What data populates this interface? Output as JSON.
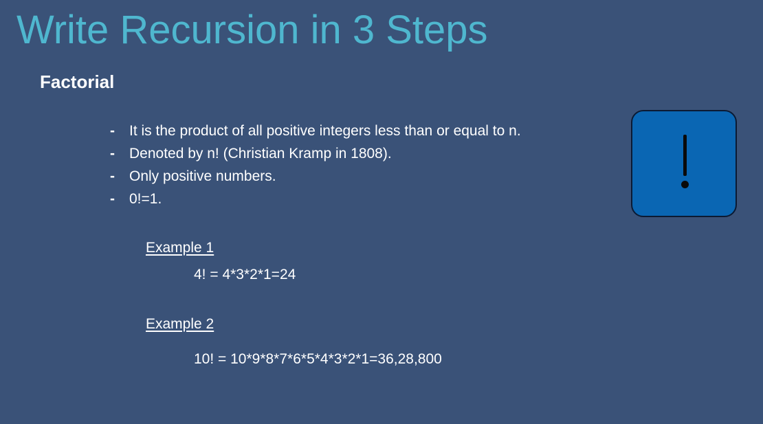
{
  "slide": {
    "title": "Write Recursion in 3 Steps",
    "subtitle": "Factorial",
    "bullets": [
      "It is the product of all positive integers less than or equal to n.",
      "Denoted by n! (Christian Kramp in 1808).",
      "Only positive numbers.",
      "0!=1."
    ],
    "bullet_marker": "-",
    "examples": [
      {
        "heading": "Example 1",
        "formula": "4! = 4*3*2*1=24"
      },
      {
        "heading": "Example 2",
        "formula": "10! = 10*9*8*7*6*5*4*3*2*1=36,28,800"
      }
    ],
    "icon": {
      "name": "exclamation-icon",
      "box_color": "#0a66b3",
      "glyph_color": "#0a0a0a"
    },
    "colors": {
      "background": "#3a5278",
      "title": "#4fb7cf",
      "text": "#ffffff"
    }
  }
}
